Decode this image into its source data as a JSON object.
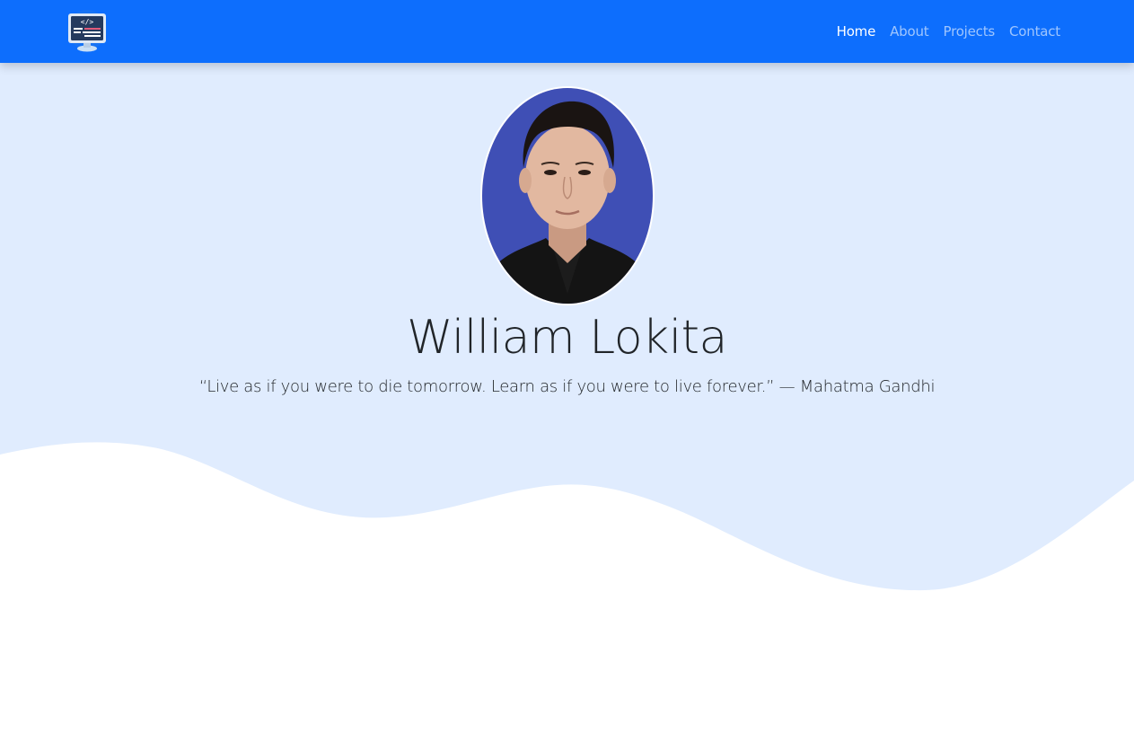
{
  "navbar": {
    "logo_icon": "monitor-code-icon",
    "links": [
      {
        "label": "Home",
        "active": true
      },
      {
        "label": "About",
        "active": false
      },
      {
        "label": "Projects",
        "active": false
      },
      {
        "label": "Contact",
        "active": false
      }
    ]
  },
  "hero": {
    "name": "William Lokita",
    "quote": "“Live as if you were to die tomorrow. Learn as if you were to live forever.” — Mahatma Gandhi"
  },
  "colors": {
    "navbar": "#0d6efd",
    "hero_background": "#e0ecfe",
    "avatar_background": "#3f4fb5",
    "text": "#212529"
  }
}
